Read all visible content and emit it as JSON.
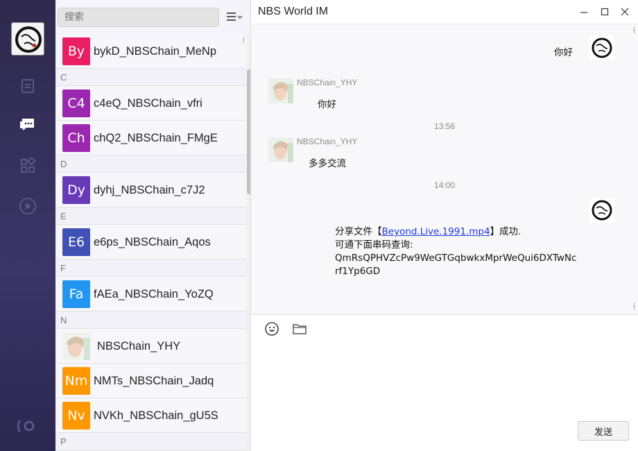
{
  "search": {
    "placeholder": "搜索"
  },
  "window": {
    "title": "NBS World IM"
  },
  "contacts": {
    "rows": [
      {
        "kind": "contact",
        "initials": "By",
        "name": "bykD_NBSChain_MeNp",
        "color": "#e91e63"
      },
      {
        "kind": "letter",
        "letter": "C"
      },
      {
        "kind": "contact",
        "initials": "C4",
        "name": "c4eQ_NBSChain_vfri",
        "color": "#9c27b0"
      },
      {
        "kind": "contact",
        "initials": "Ch",
        "name": "chQ2_NBSChain_FMgE",
        "color": "#9c27b0"
      },
      {
        "kind": "letter",
        "letter": "D"
      },
      {
        "kind": "contact",
        "initials": "Dy",
        "name": "dyhj_NBSChain_c7J2",
        "color": "#673ab7"
      },
      {
        "kind": "letter",
        "letter": "E"
      },
      {
        "kind": "contact",
        "initials": "E6",
        "name": "e6ps_NBSChain_Aqos",
        "color": "#3f51b5"
      },
      {
        "kind": "letter",
        "letter": "F"
      },
      {
        "kind": "contact",
        "initials": "Fa",
        "name": "fAEa_NBSChain_YoZQ",
        "color": "#2196f3"
      },
      {
        "kind": "letter",
        "letter": "N"
      },
      {
        "kind": "contact",
        "initials": "",
        "name": "NBSChain_YHY",
        "color": "photo"
      },
      {
        "kind": "contact",
        "initials": "Nm",
        "name": "NMTs_NBSChain_Jadq",
        "color": "#ff9800"
      },
      {
        "kind": "contact",
        "initials": "Nv",
        "name": "NVKh_NBSChain_gU5S",
        "color": "#ff9800"
      },
      {
        "kind": "letter",
        "letter": "P"
      }
    ]
  },
  "messages": {
    "m1": {
      "text": "你好"
    },
    "m2": {
      "sender": "NBSChain_YHY",
      "text": "你好"
    },
    "t1": "13:56",
    "m3": {
      "sender": "NBSChain_YHY",
      "text": "多多交流"
    },
    "t2": "14:00",
    "m4": {
      "prefix": "分享文件【",
      "file_link": "Beyond.Live.1991.mp4",
      "suffix": "】成功.",
      "line2": "可通下面串码查询:",
      "code": "QmRsQPHVZcPw9WeGTGqbwkxMprWeQui6DXTwNcrf1Yp6GD"
    }
  },
  "composer": {
    "send_label": "发送"
  },
  "icons": {
    "nav": [
      "document-icon",
      "chat-icon",
      "apps-icon",
      "play-icon",
      "settings-icon"
    ],
    "toolbar": [
      "emoji-icon",
      "folder-icon"
    ]
  }
}
